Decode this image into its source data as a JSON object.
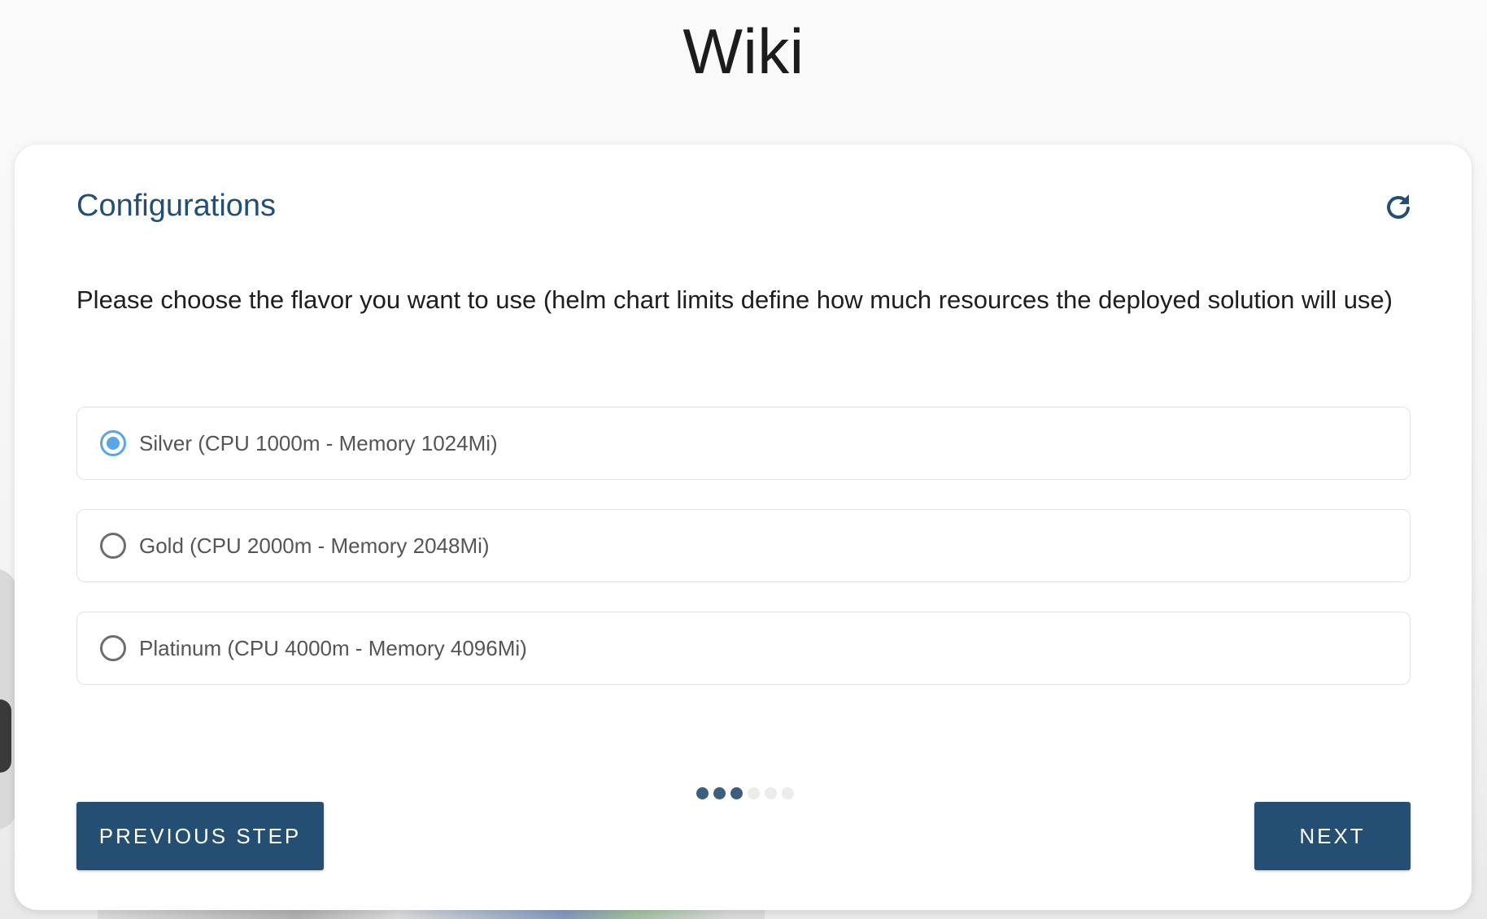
{
  "page": {
    "title": "Wiki"
  },
  "card": {
    "title": "Configurations",
    "refresh_icon": "refresh-icon",
    "instructions": "Please choose the flavor you want to use (helm chart limits define how much resources the deployed solution will use)"
  },
  "options": [
    {
      "label": "Silver (CPU 1000m - Memory 1024Mi)",
      "selected": true
    },
    {
      "label": "Gold (CPU 2000m - Memory 2048Mi)",
      "selected": false
    },
    {
      "label": "Platinum (CPU 4000m - Memory 4096Mi)",
      "selected": false
    }
  ],
  "stepper": {
    "total_steps": 6,
    "completed_steps": 3
  },
  "buttons": {
    "previous_label": "PREVIOUS STEP",
    "next_label": "NEXT"
  },
  "colors": {
    "accent": "#254f72",
    "radio_selected": "#5aa6e6",
    "title": "#244f73"
  }
}
